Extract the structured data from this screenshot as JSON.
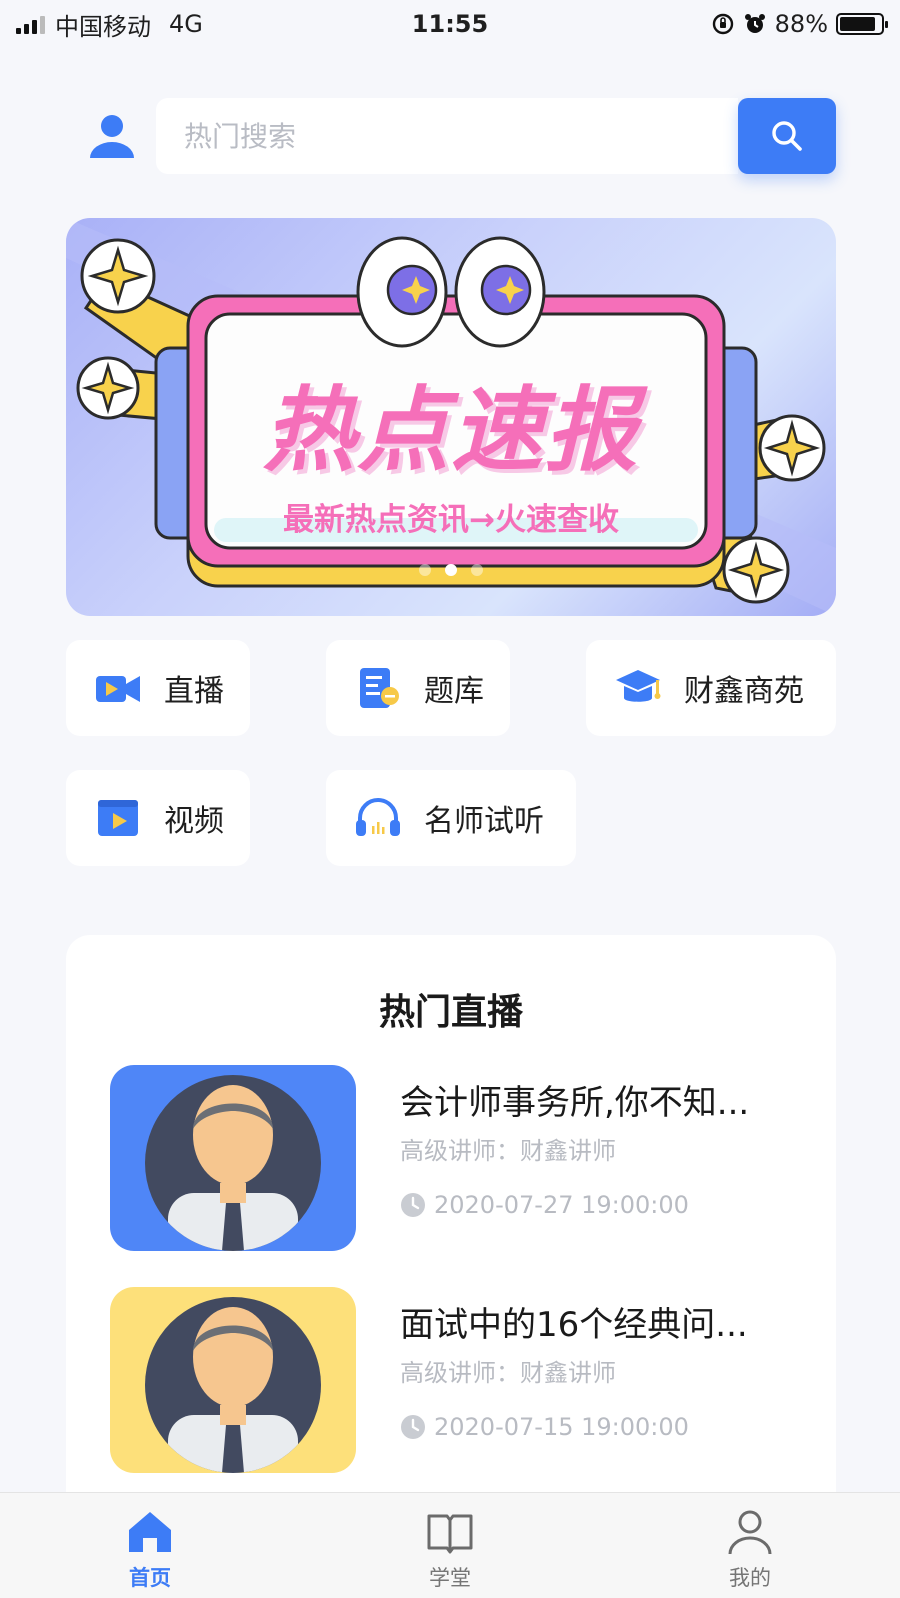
{
  "status_bar": {
    "carrier": "中国移动",
    "network": "4G",
    "time": "11:55",
    "battery": "88%",
    "battery_level": 0.88
  },
  "search": {
    "placeholder": "热门搜索",
    "icon": "search-icon"
  },
  "header": {
    "user_icon": "user-icon"
  },
  "banner": {
    "title": "热点速报",
    "subtitle": "最新热点资讯→火速查收",
    "page_count": 3,
    "active_page": 2
  },
  "quick_nav": [
    {
      "label": "直播",
      "icon": "video-camera-icon"
    },
    {
      "label": "题库",
      "icon": "question-bank-icon"
    },
    {
      "label": "财鑫商苑",
      "icon": "graduation-cap-icon"
    },
    {
      "label": "视频",
      "icon": "video-play-icon"
    },
    {
      "label": "名师试听",
      "icon": "headphones-icon"
    }
  ],
  "hot_live": {
    "title": "热门直播",
    "items": [
      {
        "title": "会计师事务所,你不知...",
        "teacher": "高级讲师：财鑫讲师",
        "time": "2020-07-27 19:00:00",
        "thumb_color": "#4f86f7"
      },
      {
        "title": "面试中的16个经典问...",
        "teacher": "高级讲师：财鑫讲师",
        "time": "2020-07-15 19:00:00",
        "thumb_color": "#fde07a"
      }
    ]
  },
  "tab_bar": {
    "tabs": [
      {
        "label": "首页",
        "icon": "home-icon",
        "active": true
      },
      {
        "label": "学堂",
        "icon": "book-icon",
        "active": false
      },
      {
        "label": "我的",
        "icon": "profile-icon",
        "active": false
      }
    ]
  },
  "colors": {
    "accent": "#3d7cf6",
    "banner_pink": "#f56fb9",
    "muted_text": "#b8bbc2"
  }
}
